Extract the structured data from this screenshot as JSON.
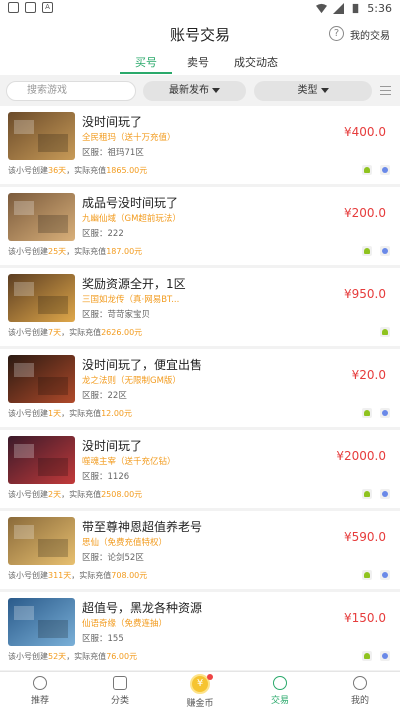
{
  "status": {
    "time": "5:36"
  },
  "header": {
    "title": "账号交易",
    "my_trade": "我的交易"
  },
  "tabs": [
    {
      "label": "买号",
      "active": true
    },
    {
      "label": "卖号",
      "active": false
    },
    {
      "label": "成交动态",
      "active": false
    }
  ],
  "filter": {
    "search_placeholder": "搜索游戏",
    "sort_label": "最新发布",
    "type_label": "类型"
  },
  "items": [
    {
      "title": "没时间玩了",
      "game": "全民租玛（送十万充值）",
      "server": "区服：祖玛71区",
      "price": "¥400.0",
      "info_prefix": "该小号创建",
      "days": "36天",
      "info_mid": "，实际充值",
      "amount": "1865.00元",
      "platforms": [
        "android",
        "ios"
      ],
      "thumb_colors": [
        "#6b4b2a",
        "#c89b58"
      ]
    },
    {
      "title": "成品号没时间玩了",
      "game": "九幽仙域（GM超前玩法）",
      "server": "区服：222",
      "price": "¥200.0",
      "info_prefix": "该小号创建",
      "days": "25天",
      "info_mid": "，实际充值",
      "amount": "187.00元",
      "platforms": [
        "android",
        "ios"
      ],
      "thumb_colors": [
        "#7a5a3c",
        "#d9b07a"
      ]
    },
    {
      "title": "奖励资源全开，1区",
      "game": "三国如龙传（真·网易BT...",
      "server": "区服：苛苛家宝贝",
      "price": "¥950.0",
      "info_prefix": "该小号创建",
      "days": "7天",
      "info_mid": "，实际充值",
      "amount": "2626.00元",
      "platforms": [
        "android"
      ],
      "thumb_colors": [
        "#5b3d22",
        "#e0a84a"
      ]
    },
    {
      "title": "没时间玩了，便宜出售",
      "game": "龙之法则（无限制GM版）",
      "server": "区服：22区",
      "price": "¥20.0",
      "info_prefix": "该小号创建",
      "days": "1天",
      "info_mid": "，实际充值",
      "amount": "12.00元",
      "platforms": [
        "android",
        "ios"
      ],
      "thumb_colors": [
        "#2a1a12",
        "#b04a2a"
      ]
    },
    {
      "title": "没时间玩了",
      "game": "噬魂主宰（送千充亿钻）",
      "server": "区服：1126",
      "price": "¥2000.0",
      "info_prefix": "该小号创建",
      "days": "2天",
      "info_mid": "，实际充值",
      "amount": "2508.00元",
      "platforms": [
        "android",
        "ios"
      ],
      "thumb_colors": [
        "#3a1a2a",
        "#c23a3a"
      ]
    },
    {
      "title": "带至尊神恩超值养老号",
      "game": "思仙（免费充值特权）",
      "server": "区服：论剑52区",
      "price": "¥590.0",
      "info_prefix": "该小号创建",
      "days": "311天",
      "info_mid": "，实际充值",
      "amount": "708.00元",
      "platforms": [
        "android",
        "ios"
      ],
      "thumb_colors": [
        "#8a6a3a",
        "#e8c070"
      ]
    },
    {
      "title": "超值号，黑龙各种资源",
      "game": "仙语奇缘（免费连抽）",
      "server": "区服：155",
      "price": "¥150.0",
      "info_prefix": "该小号创建",
      "days": "52天",
      "info_mid": "，实际充值",
      "amount": "76.00元",
      "platforms": [
        "android",
        "ios"
      ],
      "thumb_colors": [
        "#2a5a8a",
        "#7ab0d8"
      ]
    }
  ],
  "nav": [
    {
      "label": "推荐",
      "icon": "star-circle-icon"
    },
    {
      "label": "分类",
      "icon": "grid-icon"
    },
    {
      "label": "赚金币",
      "icon": "coin-icon"
    },
    {
      "label": "交易",
      "icon": "trade-icon"
    },
    {
      "label": "我的",
      "icon": "user-icon"
    }
  ]
}
